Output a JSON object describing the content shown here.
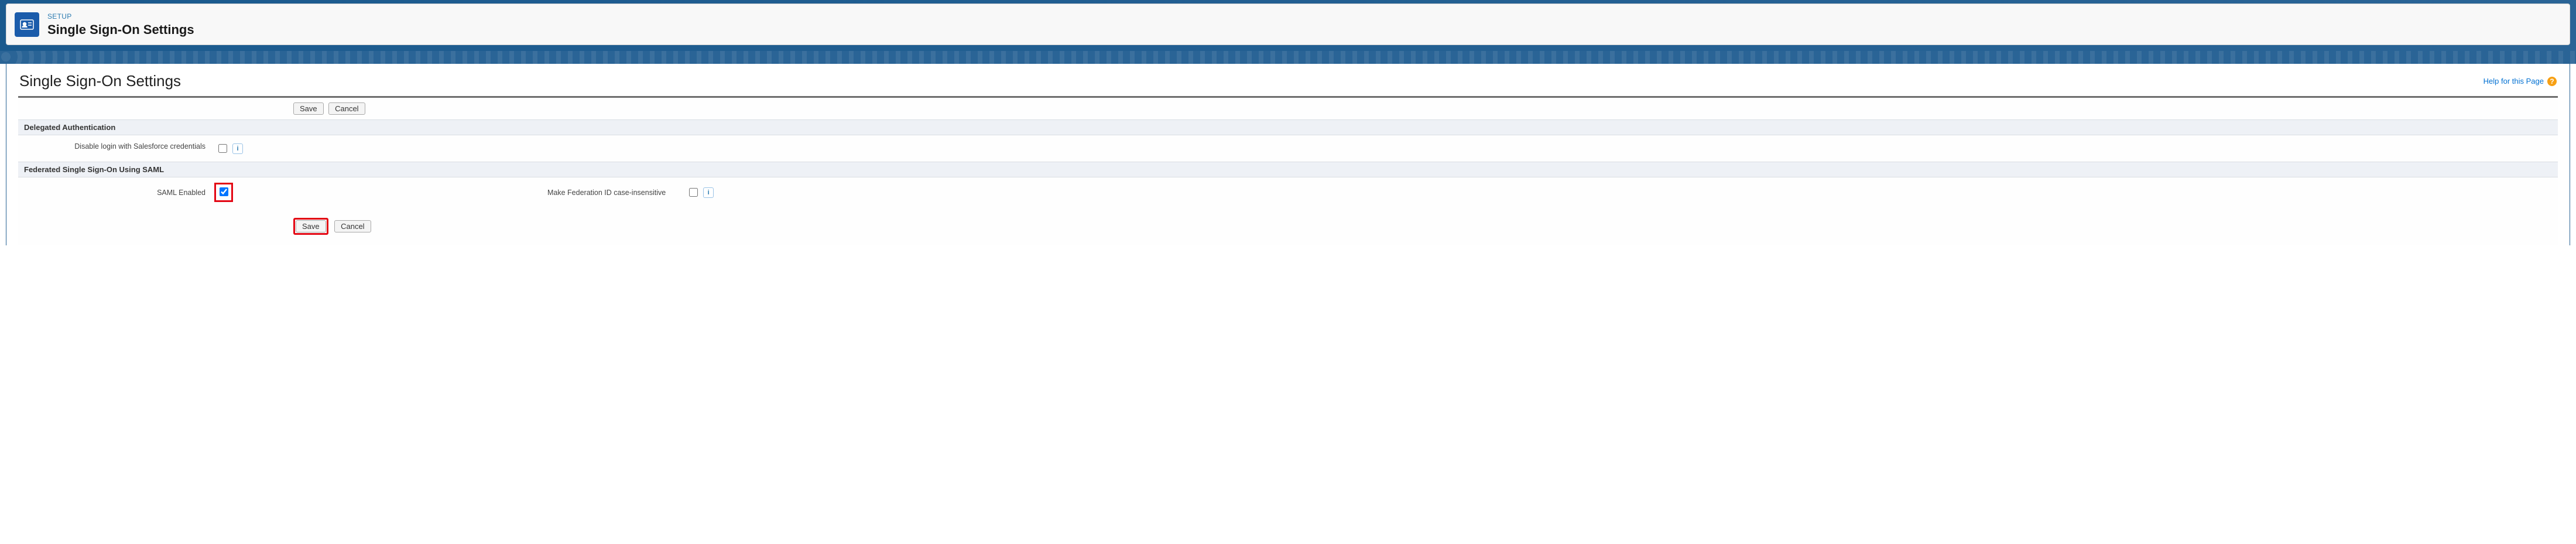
{
  "header": {
    "breadcrumb": "SETUP",
    "title": "Single Sign-On Settings"
  },
  "page": {
    "title": "Single Sign-On Settings",
    "help": "Help for this Page"
  },
  "buttons": {
    "save": "Save",
    "cancel": "Cancel"
  },
  "sections": {
    "delegated": {
      "title": "Delegated Authentication",
      "disable_login_label": "Disable login with Salesforce credentials",
      "disable_login_checked": false
    },
    "federated": {
      "title": "Federated Single Sign-On Using SAML",
      "saml_enabled_label": "SAML Enabled",
      "saml_enabled_checked": true,
      "fed_id_label": "Make Federation ID case-insensitive",
      "fed_id_checked": false
    }
  }
}
